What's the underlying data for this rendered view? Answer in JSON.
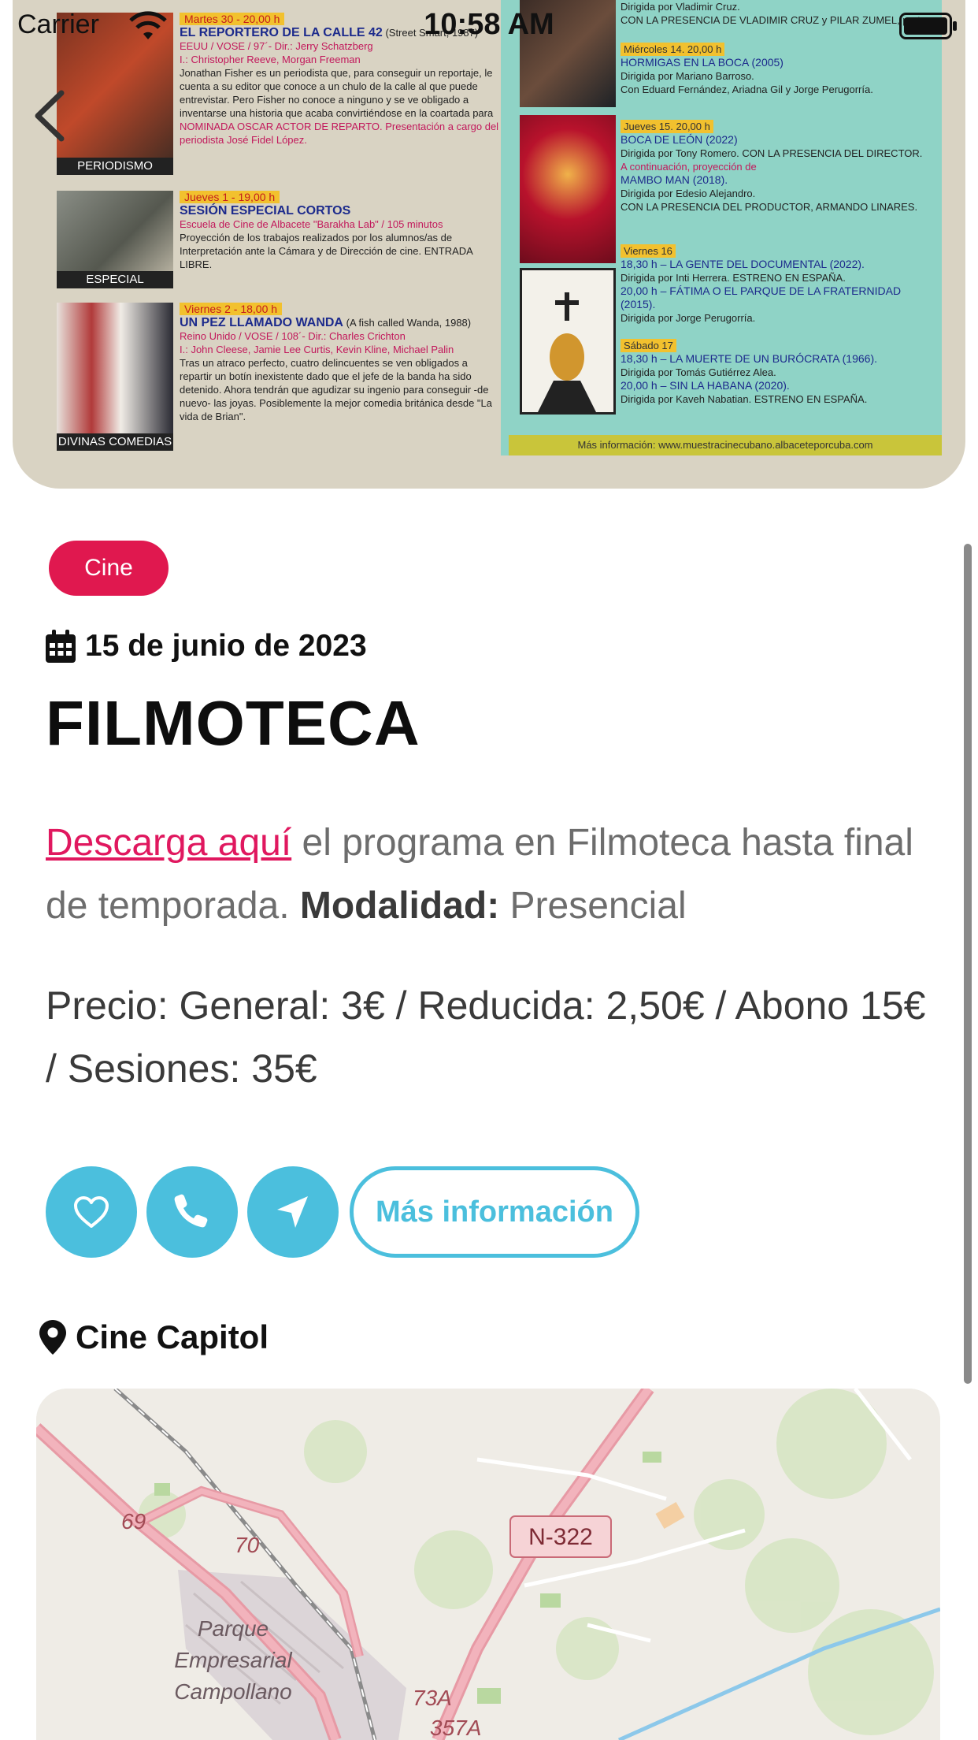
{
  "status_bar": {
    "carrier": "Carrier",
    "time": "10:58 AM"
  },
  "poster": {
    "left_events": [
      {
        "caption": "PERIODISMO",
        "date": "Martes 30 - 20,00 h",
        "title": "EL REPORTERO DE LA CALLE 42",
        "title_extra": "(Street Smart, 1987)",
        "sub": "EEUU / VOSE / 97´- Dir.: Jerry Schatzberg",
        "cast": "I.: Christopher Reeve, Morgan Freeman",
        "body": "Jonathan Fisher es un periodista que, para conseguir un reportaje, le cuenta a su editor que conoce a un chulo de la calle al que puede entrevistar. Pero Fisher no conoce a ninguno y se ve obligado a inventarse una historia que acaba convirtiéndose en la coartada para un golpe.",
        "note": "NOMINADA OSCAR ACTOR DE REPARTO. Presentación a cargo del periodista José Fidel López."
      },
      {
        "caption": "ESPECIAL",
        "date": "Jueves 1 - 19,00 h",
        "title": "SESIÓN ESPECIAL CORTOS",
        "title_extra": "",
        "sub": "Escuela de Cine de Albacete \"Barakha Lab\" / 105 minutos",
        "cast": "",
        "body": "Proyección de los trabajos realizados por los alumnos/as de Interpretación ante la Cámara y de Dirección de cine. ENTRADA LIBRE.",
        "note": ""
      },
      {
        "caption": "DIVINAS COMEDIAS",
        "date": "Viernes 2 - 18,00 h",
        "title": "UN PEZ LLAMADO WANDA",
        "title_extra": "(A fish called Wanda, 1988)",
        "sub": "Reino Unido / VOSE / 108´- Dir.: Charles Crichton",
        "cast": "I.: John Cleese, Jamie Lee Curtis, Kevin Kline, Michael Palin",
        "body": "Tras un atraco perfecto, cuatro delincuentes se ven obligados a repartir un botín inexistente dado que el jefe de la banda ha sido detenido. Ahora tendrán que agudizar su ingenio para conseguir -de nuevo- las joyas. Posiblemente la mejor comedia británica desde \"La vida de Brian\".",
        "note": ""
      }
    ],
    "right_top": {
      "line1": "Dirigida por Vladimir Cruz.",
      "line2": "CON LA PRESENCIA DE VLADIMIR CRUZ y PILAR ZUMEL, protagonista del"
    },
    "right_events": [
      {
        "date": "Miércoles 14. 20,00 h",
        "lines": [
          "HORMIGAS EN LA BOCA (2005)",
          "Dirigida por Mariano Barroso.",
          "Con Eduard Fernández, Ariadna Gil y Jorge Perugorría."
        ]
      },
      {
        "date": "Jueves 15. 20,00 h",
        "lines": [
          "BOCA DE LEÓN (2022)",
          "Dirigida por Tony Romero. CON LA PRESENCIA DEL DIRECTOR.",
          "A continuación, proyección de",
          "MAMBO MAN (2018).",
          "Dirigida por Edesio Alejandro.",
          "CON LA PRESENCIA DEL PRODUCTOR, ARMANDO LINARES."
        ]
      },
      {
        "date": "Viernes 16",
        "lines": [
          "18,30 h – LA GENTE DEL DOCUMENTAL (2022).",
          "Dirigida por Inti Herrera. ESTRENO EN ESPAÑA.",
          "20,00 h – FÁTIMA O EL PARQUE DE LA FRATERNIDAD (2015).",
          "Dirigida por Jorge Perugorría."
        ]
      },
      {
        "date": "Sábado 17",
        "lines": [
          "18,30 h – LA MUERTE DE UN BURÓCRATA (1966).",
          "Dirigida por Tomás Gutiérrez Alea.",
          "20,00 h – SIN LA HABANA (2020).",
          "Dirigida por Kaveh Nabatian. ESTRENO EN ESPAÑA."
        ]
      }
    ],
    "footer": "Más información: www.muestracinecubano.albaceteporcuba.com"
  },
  "event": {
    "category": "Cine",
    "date": "15 de junio de 2023",
    "title": "FILMOTECA",
    "description_link": "Descarga aquí",
    "description_text": " el programa en Filmoteca hasta final de temporada. ",
    "modality_label": "Modalidad:",
    "modality_value": " Presencial",
    "price": "Precio: General: 3€ / Reducida: 2,50€ / Abono 15€ / Sesiones: 35€",
    "more_info_label": "Más información",
    "venue": "Cine Capitol"
  },
  "map": {
    "road_labels": [
      "69",
      "70",
      "N-322",
      "73A",
      "357A"
    ],
    "place_label": [
      "Parque",
      "Empresarial",
      "Campollano"
    ]
  },
  "colors": {
    "accent_pink": "#e0184f",
    "accent_cyan": "#4bbfdd"
  },
  "icons": {
    "back": "chevron-left-icon",
    "calendar": "calendar-icon",
    "favorite": "heart-icon",
    "call": "phone-icon",
    "directions": "navigation-arrow-icon",
    "location": "map-pin-icon"
  }
}
